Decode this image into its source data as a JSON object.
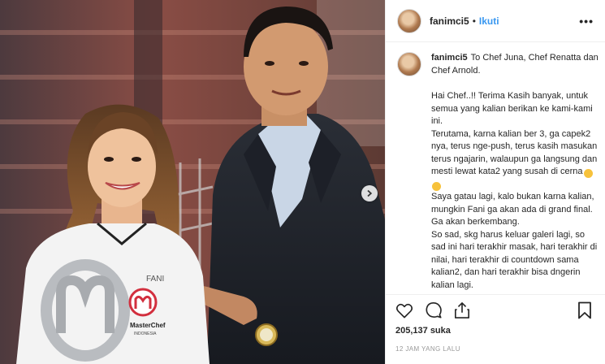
{
  "header": {
    "username": "fanimci5",
    "separator": "•",
    "follow_label": "Ikuti",
    "more_label": "•••"
  },
  "caption": {
    "username": "fanimci5",
    "lines": [
      "To Chef Juna, Chef Renatta dan Chef Arnold.",
      "",
      "Hai Chef..!! Terima Kasih banyak, untuk semua yang kalian berikan ke kami-kami ini.",
      "Terutama, karna kalian ber 3, ga capek2 nya, terus nge-push, terus kasih masukan terus ngajarin, walaupun ga langsung dan mesti lewat kata2 yang susah di cerna",
      "Saya gatau lagi, kalo bukan karna kalian, mungkin Fani ga akan ada di grand final.",
      "Ga akan berkembang.",
      "So sad, skg harus keluar galeri lagi, so sad ini hari terakhir masak, hari terakhir di nilai, hari terakhir di countdown sama kalian2, dan hari terakhir bisa dngerin kalian lagi."
    ],
    "emojis": [
      "😂",
      "😝"
    ]
  },
  "actions": {
    "like_icon": "heart-icon",
    "comment_icon": "comment-icon",
    "share_icon": "share-icon",
    "save_icon": "bookmark-icon",
    "likes": "205,137 suka",
    "timestamp": "12 JAM YANG LALU"
  },
  "media": {
    "apron_text": "FANI",
    "badge_text": "MasterChef",
    "badge_sub": "INDONESIA"
  },
  "colors": {
    "accent": "#3897f0",
    "text": "#262626",
    "muted": "#999999",
    "border": "#efefef"
  }
}
